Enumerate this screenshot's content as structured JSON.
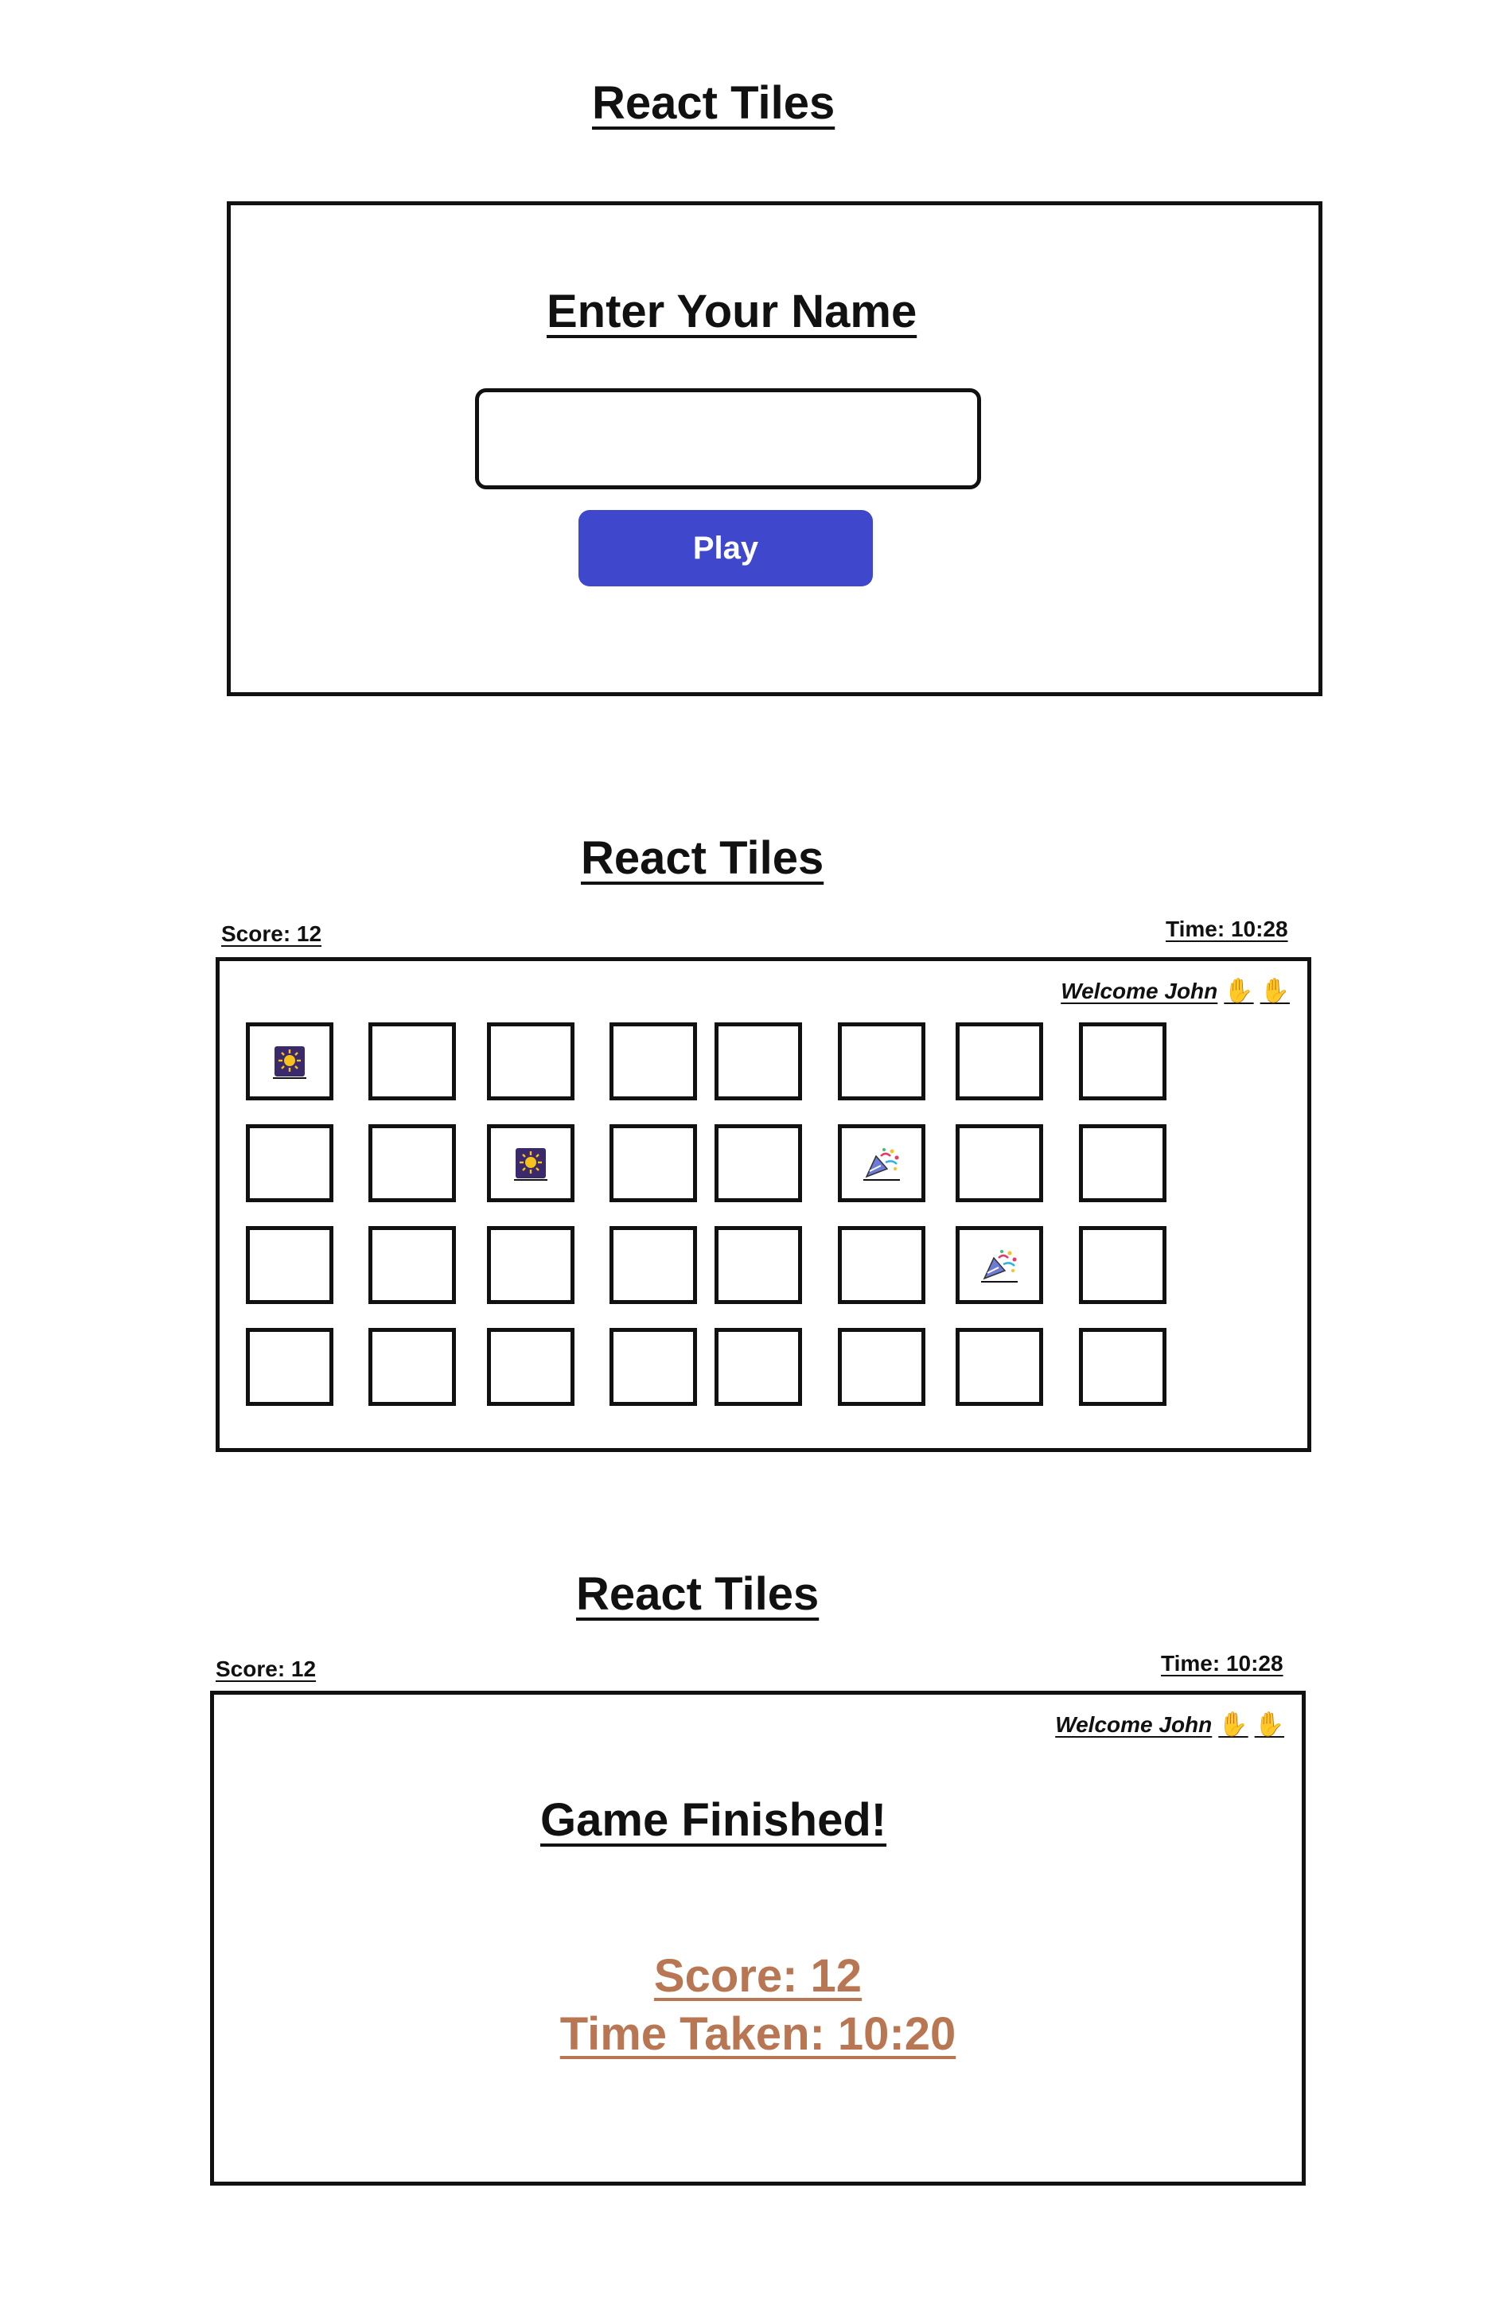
{
  "app_title": "React Tiles",
  "screen1": {
    "heading": "Enter Your Name",
    "name_input": {
      "value": "",
      "placeholder": ""
    },
    "play_label": "Play"
  },
  "screen2": {
    "score_label": "Score: 12",
    "time_label": "Time: 10:28",
    "welcome_text": "Welcome  John",
    "wave_icon": "waving-hand-icon",
    "grid": {
      "rows": 4,
      "cols": 8,
      "revealed": [
        {
          "row": 0,
          "col": 0,
          "icon": "firework-icon"
        },
        {
          "row": 1,
          "col": 2,
          "icon": "firework-icon"
        },
        {
          "row": 1,
          "col": 5,
          "icon": "party-popper-icon"
        },
        {
          "row": 2,
          "col": 6,
          "icon": "party-popper-icon"
        }
      ]
    }
  },
  "screen3": {
    "score_label": "Score: 12",
    "time_label": "Time: 10:28",
    "welcome_text": "Welcome  John",
    "heading": "Game Finished!",
    "result_score": "Score: 12",
    "result_time": "Time Taken: 10:20",
    "result_color": "#b87653"
  },
  "colors": {
    "primary_button": "#3f48cc",
    "border": "#111111",
    "wave": "#e6a400"
  }
}
